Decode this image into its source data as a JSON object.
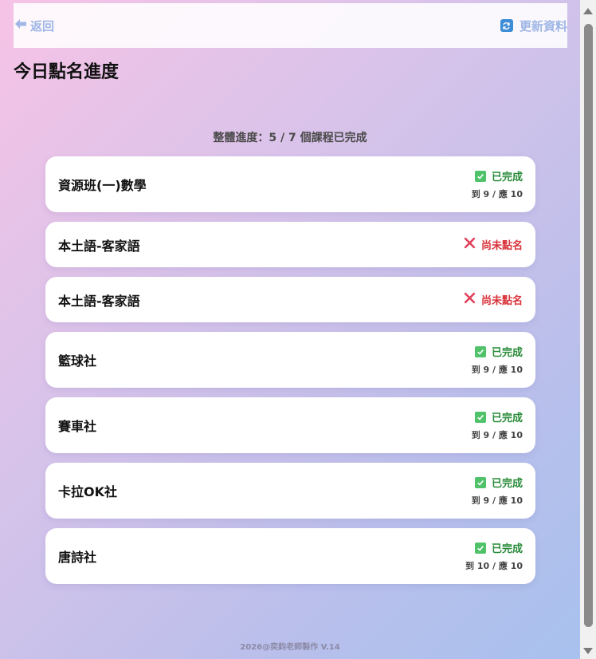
{
  "header": {
    "back_label": "返回",
    "refresh_label": "更新資料"
  },
  "page_title": "今日點名進度",
  "overall_progress": "整體進度：5 / 7 個課程已完成",
  "courses": [
    {
      "name": "資源班(一)數學",
      "status": "已完成",
      "count": "到 9 / 應 10"
    },
    {
      "name": "本土語-客家語",
      "status": "尚未點名"
    },
    {
      "name": "本土語-客家語",
      "status": "尚未點名"
    },
    {
      "name": "籃球社",
      "status": "已完成",
      "count": "到 9 / 應 10"
    },
    {
      "name": "賽車社",
      "status": "已完成",
      "count": "到 9 / 應 10"
    },
    {
      "name": "卡拉OK社",
      "status": "已完成",
      "count": "到 9 / 應 10"
    },
    {
      "name": "唐詩社",
      "status": "已完成",
      "count": "到 10 / 應 10"
    }
  ],
  "footer": "2026@奕鈞老師製作 V.14",
  "colors": {
    "done": "#2a8c3a",
    "pending": "#d8333a",
    "link": "#9fb6e6"
  }
}
